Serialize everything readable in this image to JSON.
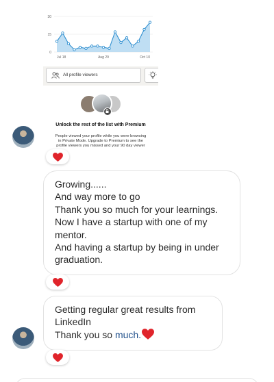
{
  "shared_screenshot": {
    "chart_data": {
      "type": "line",
      "x_ticks": [
        "Jul 18",
        "Aug 29",
        "Oct 10"
      ],
      "y_ticks": [
        0,
        15,
        30
      ],
      "ylim": [
        0,
        30
      ],
      "values": [
        9,
        16,
        7,
        2,
        4,
        3,
        5,
        5,
        4,
        3,
        17,
        8,
        12,
        5,
        9,
        19,
        25
      ],
      "grid": true,
      "line_color": "#2f8fd0",
      "fill_color": "#a9d3ef"
    },
    "viewers_button_label": "All profile viewers",
    "viewers_icon": "people-icon",
    "tip_icon": "lightbulb-icon"
  },
  "premium_prompt": {
    "title": "Unlock the rest of the list with Premium",
    "description_lines": [
      "People viewed your profile while you were browsing",
      "in Private Mode. Upgrade to Premium to see the",
      "profile viewers you missed and your 90 day viewer"
    ],
    "lock_icon": "lock-icon"
  },
  "messages": [
    {
      "lines": [
        "Growing......",
        "And way more to go",
        "Thank you so much for your learnings.",
        "Now I have a startup with one of my",
        "mentor.",
        "And having a startup by being in under",
        "graduation."
      ],
      "reaction": "heart-icon"
    },
    {
      "line1": "Getting regular great results from",
      "line2": "LinkedIn",
      "line3_prefix": "Thank you so ",
      "line3_link": "much.",
      "reaction": "heart-icon"
    }
  ],
  "colors": {
    "heart": "#e0242b",
    "link": "#1f4f8a",
    "bubble_border": "#e2e2e2"
  }
}
